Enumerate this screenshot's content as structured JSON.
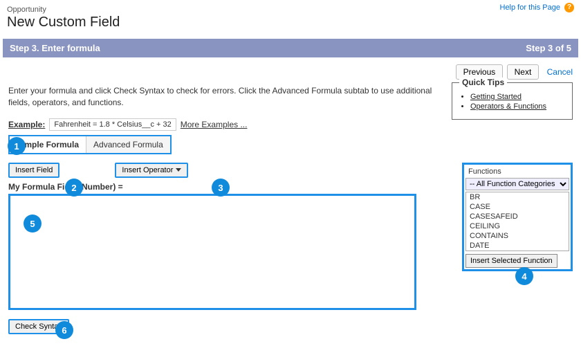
{
  "header": {
    "breadcrumb": "Opportunity",
    "title": "New Custom Field",
    "help_text": "Help for this Page",
    "help_glyph": "?"
  },
  "step_bar": {
    "left": "Step 3. Enter formula",
    "right": "Step 3 of 5"
  },
  "nav": {
    "previous": "Previous",
    "next": "Next",
    "cancel": "Cancel"
  },
  "instructions": "Enter your formula and click Check Syntax to check for errors. Click the Advanced Formula subtab to use additional fields, operators, and functions.",
  "example": {
    "label": "Example:",
    "text": "Fahrenheit = 1.8 * Celsius__c + 32",
    "more": "More Examples ..."
  },
  "tabs": {
    "simple": "Simple Formula",
    "advanced": "Advanced Formula"
  },
  "buttons": {
    "insert_field": "Insert Field",
    "insert_operator": "Insert Operator",
    "check_syntax": "Check Syntax",
    "insert_selected_function": "Insert Selected Function"
  },
  "formula": {
    "label": "My Formula Field (Number) ="
  },
  "functions": {
    "title": "Functions",
    "category": "-- All Function Categories --",
    "items": [
      "BR",
      "CASE",
      "CASESAFEID",
      "CEILING",
      "CONTAINS",
      "DATE"
    ]
  },
  "quick_tips": {
    "title": "Quick Tips",
    "items": [
      "Getting Started",
      "Operators & Functions"
    ]
  },
  "badges": [
    "1",
    "2",
    "3",
    "4",
    "5",
    "6"
  ]
}
